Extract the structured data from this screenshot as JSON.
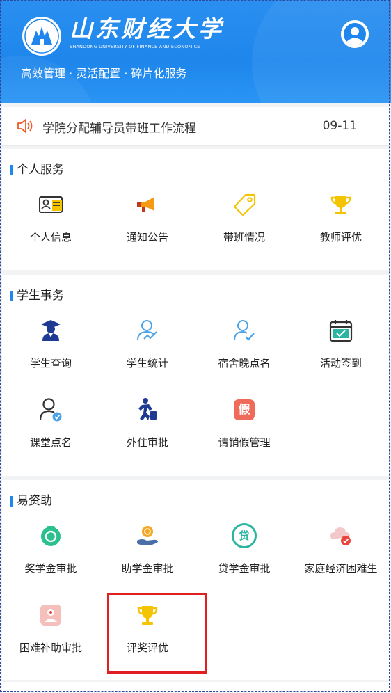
{
  "header": {
    "logo_cn": "山东财经大学",
    "logo_en": "SHANDONG UNIVERSITY OF FINANCE AND ECONOMICS",
    "slogan": "高效管理 · 灵活配置 · 碎片化服务",
    "avatar_icon": "user-avatar-icon"
  },
  "notice": {
    "icon": "speaker-icon",
    "text": "学院分配辅导员带班工作流程",
    "date": "09-11"
  },
  "sections": [
    {
      "title": "个人服务",
      "items": [
        {
          "label": "个人信息",
          "icon": "id-card-icon"
        },
        {
          "label": "通知公告",
          "icon": "megaphone-icon"
        },
        {
          "label": "带班情况",
          "icon": "tag-icon"
        },
        {
          "label": "教师评优",
          "icon": "trophy-icon"
        }
      ]
    },
    {
      "title": "学生事务",
      "items": [
        {
          "label": "学生查询",
          "icon": "graduate-icon"
        },
        {
          "label": "学生统计",
          "icon": "user-chart-icon"
        },
        {
          "label": "宿舍晚点名",
          "icon": "user-check-icon"
        },
        {
          "label": "活动签到",
          "icon": "calendar-check-icon"
        },
        {
          "label": "课堂点名",
          "icon": "user-verified-icon"
        },
        {
          "label": "外住审批",
          "icon": "person-walking-icon"
        },
        {
          "label": "请销假管理",
          "icon": "leave-icon"
        }
      ]
    },
    {
      "title": "易资助",
      "items": [
        {
          "label": "奖学金审批",
          "icon": "money-bag-icon"
        },
        {
          "label": "助学金审批",
          "icon": "hand-coin-icon"
        },
        {
          "label": "贷学金审批",
          "icon": "loan-icon"
        },
        {
          "label": "家庭经济困难生",
          "icon": "cloud-alert-icon"
        },
        {
          "label": "困难补助审批",
          "icon": "support-icon"
        },
        {
          "label": "评奖评优",
          "icon": "trophy-icon"
        }
      ]
    }
  ],
  "colors": {
    "header_blue": "#1e86ec",
    "accent_blue": "#1e86ec",
    "highlight_red": "#e02020",
    "trophy_yellow": "#f5c400"
  },
  "leave_char": "假",
  "loan_char": "贷"
}
